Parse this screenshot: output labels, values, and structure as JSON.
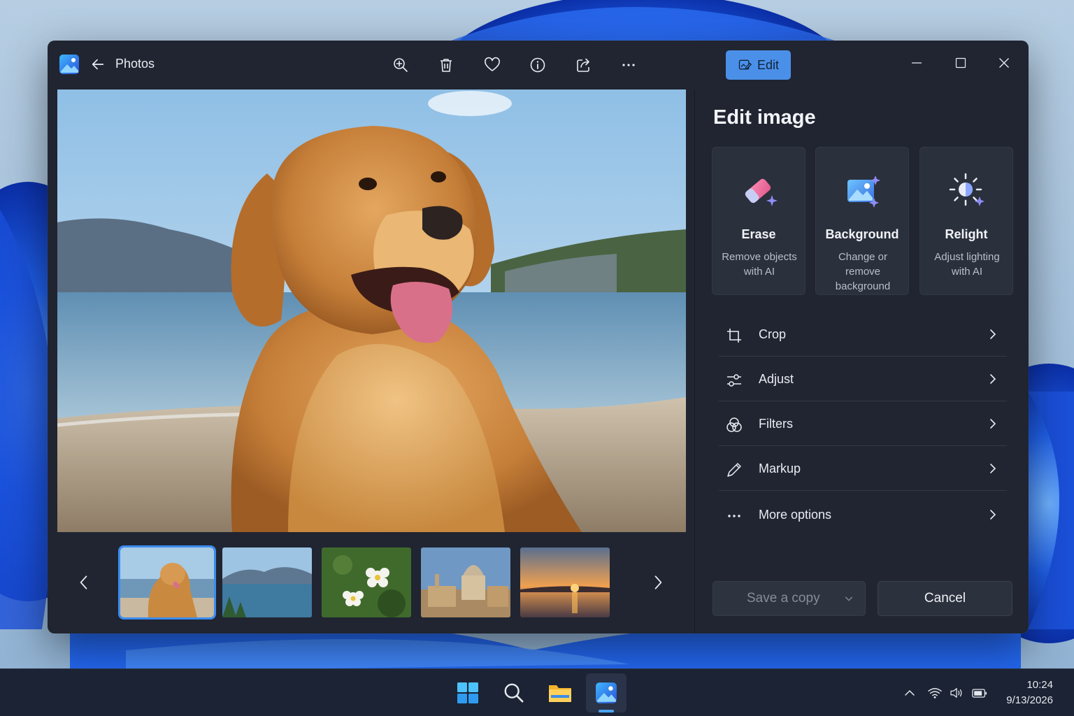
{
  "window": {
    "title": "Photos",
    "edit_label": "Edit"
  },
  "toolbar": {
    "icons": [
      "zoom-in-icon",
      "delete-icon",
      "heart-icon",
      "info-icon",
      "share-icon",
      "more-icon"
    ]
  },
  "panel": {
    "title": "Edit image",
    "ai_tools": [
      {
        "title": "Erase",
        "description": "Remove objects with AI",
        "icon": "eraser-icon"
      },
      {
        "title": "Background",
        "description": "Change or remove background",
        "icon": "background-icon"
      },
      {
        "title": "Relight",
        "description": "Adjust lighting with AI",
        "icon": "relight-icon"
      }
    ],
    "options": [
      {
        "label": "Crop",
        "icon": "crop-icon"
      },
      {
        "label": "Adjust",
        "icon": "sliders-icon"
      },
      {
        "label": "Filters",
        "icon": "filters-icon"
      },
      {
        "label": "Markup",
        "icon": "pen-icon"
      },
      {
        "label": "More options",
        "icon": "more-icon"
      }
    ],
    "save_label": "Save a copy",
    "cancel_label": "Cancel"
  },
  "filmstrip": {
    "thumbnails": [
      "dog-on-beach",
      "lake-and-mountains",
      "white-flowers",
      "domed-building",
      "sunset-over-water"
    ],
    "selected_index": 0
  },
  "taskbar": {
    "apps": [
      "start-icon",
      "search-icon",
      "file-explorer-icon",
      "photos-icon"
    ],
    "active_app": "photos-icon",
    "time": "10:24",
    "date": "9/13/2026"
  },
  "colors": {
    "accent": "#4b90e8",
    "window_bg": "#202531",
    "card_bg": "#2a303c",
    "taskbar_bg": "#1b2334"
  }
}
